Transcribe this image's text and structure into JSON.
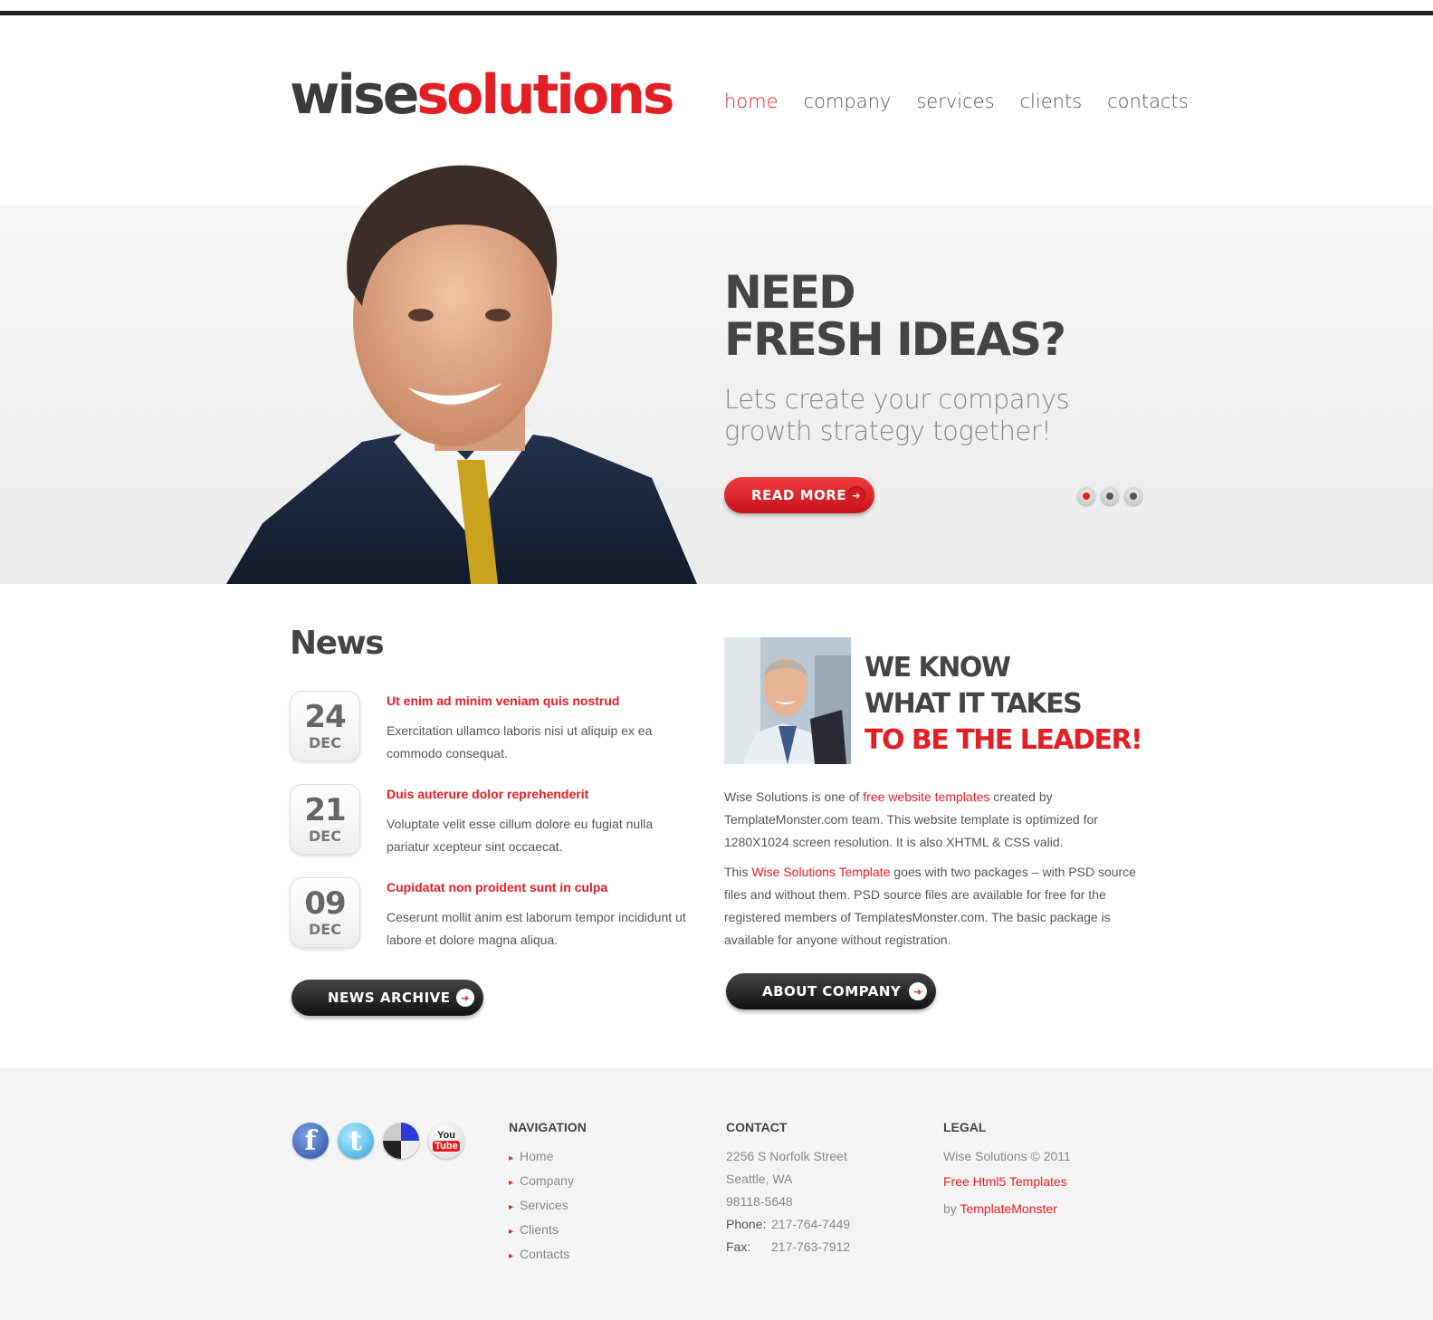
{
  "header": {
    "logo": {
      "part1": "wise",
      "part2": "solutions"
    },
    "nav": [
      {
        "label": "home",
        "active": true
      },
      {
        "label": "company",
        "active": false
      },
      {
        "label": "services",
        "active": false
      },
      {
        "label": "clients",
        "active": false
      },
      {
        "label": "contacts",
        "active": false
      }
    ]
  },
  "hero": {
    "title_line1": "NEED",
    "title_line2": "FRESH IDEAS?",
    "subtitle": "Lets create your companys growth strategy together!",
    "button_label": "READ MORE",
    "slider": {
      "count": 3,
      "active_index": 0
    }
  },
  "news": {
    "heading": "News",
    "items": [
      {
        "day": "24",
        "month": "DEC",
        "title": "Ut enim ad minim veniam quis nostrud",
        "text": "Exercitation ullamco laboris nisi ut aliquip ex ea commodo consequat."
      },
      {
        "day": "21",
        "month": "DEC",
        "title": "Duis auterure dolor reprehenderit",
        "text": "Voluptate velit esse cillum dolore eu fugiat nulla pariatur xcepteur sint occaecat."
      },
      {
        "day": "09",
        "month": "DEC",
        "title": "Cupidatat non proident sunt in culpa",
        "text": "Ceserunt mollit anim est laborum tempor incididunt ut labore et dolore magna aliqua."
      }
    ],
    "button_label": "NEWS ARCHIVE"
  },
  "about": {
    "title_line1": "WE KNOW",
    "title_line2": "WHAT IT TAKES",
    "title_line3": "TO BE THE LEADER!",
    "p1": {
      "a": "Wise Solutions is one of ",
      "link": "free website templates",
      "b": " created by TemplateMonster.com team. This website template is optimized for 1280X1024 screen resolution. It is also XHTML & CSS valid."
    },
    "p2": {
      "a": "This ",
      "link": "Wise Solutions Template",
      "b": " goes with two packages – with PSD source files and without them. PSD source files are available for free for the registered members of TemplatesMonster.com. The basic package is available for anyone without registration."
    },
    "button_label": "ABOUT COMPANY"
  },
  "footer": {
    "social": [
      "facebook-icon",
      "twitter-icon",
      "delicious-icon",
      "youtube-icon"
    ],
    "youtube_text": {
      "you": "You",
      "tube": "Tube"
    },
    "facebook_glyph": "f",
    "twitter_glyph": "t",
    "navigation": {
      "heading": "NAVIGATION",
      "items": [
        "Home",
        "Company",
        "Services",
        "Clients",
        "Contacts"
      ]
    },
    "contact": {
      "heading": "CONTACT",
      "street": "2256 S Norfolk Street",
      "city": "Seattle, WA",
      "zip": "98118-5648",
      "phone_label": "Phone:",
      "phone": "217-764-7449",
      "fax_label": "Fax:",
      "fax": "217-763-7912"
    },
    "legal": {
      "heading": "LEGAL",
      "copyright": "Wise Solutions © 2011",
      "link": "Free Html5 Templates",
      "by": "by ",
      "by_link": "TemplateMonster"
    }
  },
  "colors": {
    "accent": "#e31e24",
    "dark_text": "#444444",
    "footer_bg": "#f4f4f4"
  }
}
